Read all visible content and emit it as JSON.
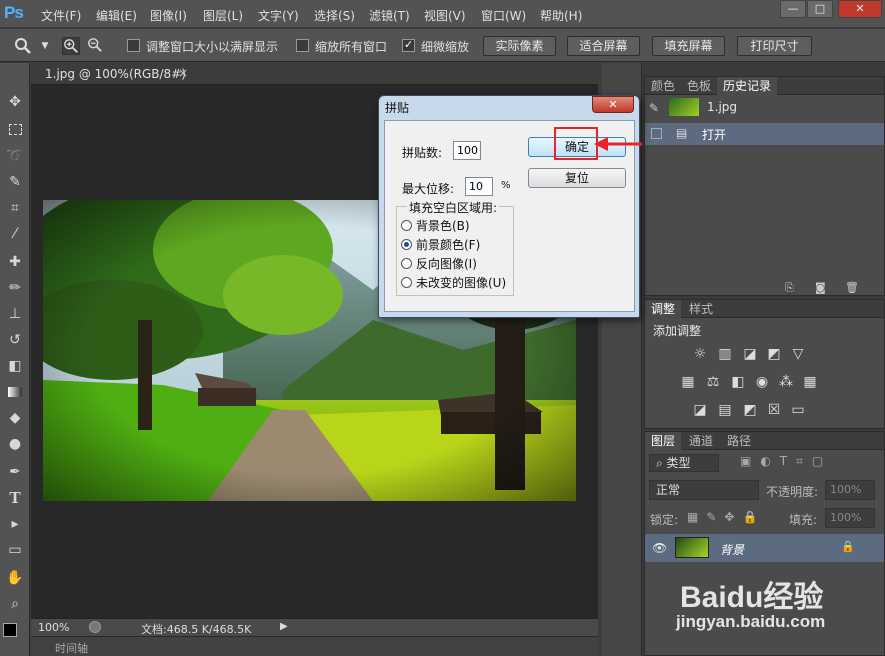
{
  "app": {
    "logo": "Ps"
  },
  "menu": [
    "文件(F)",
    "编辑(E)",
    "图像(I)",
    "图层(L)",
    "文字(Y)",
    "选择(S)",
    "滤镜(T)",
    "视图(V)",
    "窗口(W)",
    "帮助(H)"
  ],
  "window_controls": {
    "minimize": "—",
    "restore": "□",
    "close": "✕"
  },
  "options": {
    "resize_windows_label": "调整窗口大小以满屏显示",
    "zoom_all_label": "缩放所有窗口",
    "scrubby_zoom_label": "细微缩放",
    "actual_pixels": "实际像素",
    "fit_screen": "适合屏幕",
    "fill_screen": "填充屏幕",
    "print_size": "打印尺寸"
  },
  "document": {
    "tab_label": "1.jpg @ 100%(RGB/8#)",
    "tab_close": "×"
  },
  "status": {
    "zoom": "100%",
    "doc_size": "文档:468.5 K/468.5K"
  },
  "timeline": {
    "label": "时间轴"
  },
  "dialog": {
    "title": "拼贴",
    "tiles_label": "拼贴数:",
    "tiles_value": "100",
    "max_offset_label": "最大位移:",
    "max_offset_value": "10",
    "percent": "%",
    "fill_group_label": "填充空白区域用:",
    "options": [
      "背景色(B)",
      "前景颜色(F)",
      "反向图像(I)",
      "未改变的图像(U)"
    ],
    "selected_option": 1,
    "ok": "确定",
    "reset": "复位",
    "close": "✕"
  },
  "history_panel": {
    "tabs": [
      "颜色",
      "色板",
      "历史记录"
    ],
    "snapshot_name": "1.jpg",
    "step": "打开"
  },
  "adjustments_panel": {
    "tabs": [
      "调整",
      "样式"
    ],
    "heading": "添加调整"
  },
  "layers_panel": {
    "tabs": [
      "图层",
      "通道",
      "路径"
    ],
    "filter_kind": "类型",
    "blend_mode": "正常",
    "opacity_label": "不透明度:",
    "opacity_value": "100%",
    "lock_label": "锁定:",
    "fill_label": "填充:",
    "fill_value": "100%",
    "layer_name": "背景"
  },
  "watermark": {
    "brand": "Baidu经验",
    "url": "jingyan.baidu.com"
  },
  "colors": {
    "accent_red": "#e8242b",
    "selected_row": "#5d6b80"
  }
}
